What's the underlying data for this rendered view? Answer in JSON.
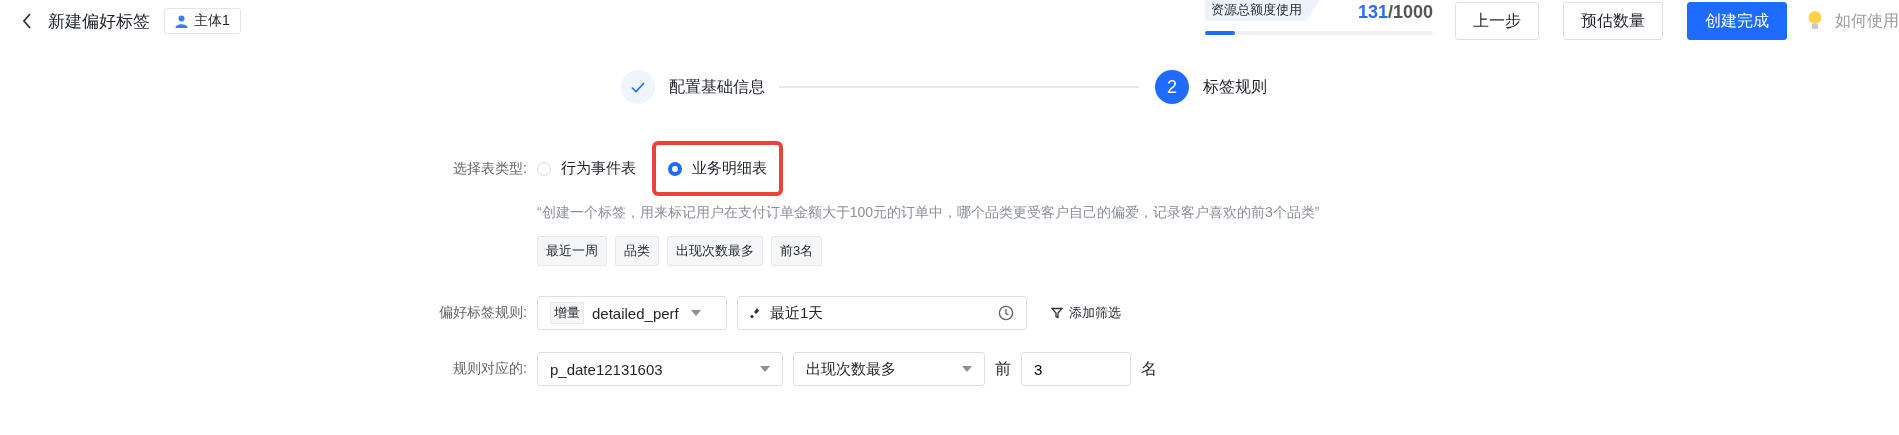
{
  "header": {
    "title": "新建偏好标签",
    "subject_badge": "主体1"
  },
  "quota": {
    "label": "资源总额度使用",
    "used": "131",
    "total": "/1000",
    "level": 0.131
  },
  "buttons": [
    {
      "label": "上一步",
      "kind": "default"
    },
    {
      "label": "预估数量",
      "kind": "default"
    },
    {
      "label": "创建完成",
      "kind": "primary"
    }
  ],
  "help_link": "如何使用",
  "steps": [
    {
      "label": "配置基础信息",
      "done": true
    },
    {
      "number": "2",
      "label": "标签规则",
      "done": false
    }
  ],
  "form": {
    "table_type": {
      "label": "选择表类型:",
      "options": [
        {
          "label": "行为事件表",
          "selected": false,
          "highlighted": false
        },
        {
          "label": "业务明细表",
          "selected": true,
          "highlighted": true
        }
      ]
    },
    "example": "“创建一个标签，用来标记用户在支付订单金额大于100元的订单中，哪个品类更受客户自己的偏爱，记录客户喜欢的前3个品类”",
    "example_tags": [
      "最近一周",
      "品类",
      "出现次数最多",
      "前3名"
    ],
    "rule": {
      "label": "偏好标签规则:",
      "table_tag": "增量",
      "table": "detailed_perf",
      "date_range": "最近1天",
      "add_filter": "添加筛选"
    },
    "mapping": {
      "label": "规则对应的:",
      "field": "p_date12131603",
      "method": "出现次数最多",
      "prefix": "前",
      "top_n": "3",
      "suffix": "名"
    }
  }
}
